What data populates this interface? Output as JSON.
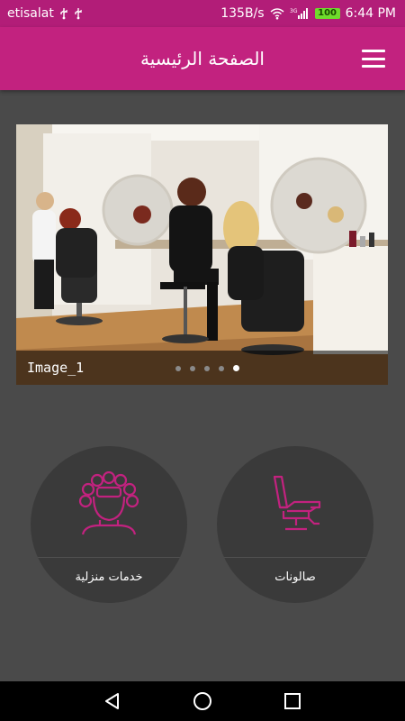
{
  "status_bar": {
    "carrier": "etisalat",
    "usb_icons": [
      "usb-icon",
      "usb-icon"
    ],
    "speed": "135B/s",
    "network": "3G",
    "battery": "100",
    "time": "6:44 PM"
  },
  "app_bar": {
    "title": "الصفحة الرئيسية",
    "menu_icon": "hamburger-menu-icon"
  },
  "slider": {
    "caption": "Image_1",
    "page_count": 5,
    "active_index": 4
  },
  "categories": [
    {
      "label": "خدمات منزلية",
      "icon": "curlers-head-icon"
    },
    {
      "label": "صالونات",
      "icon": "salon-chair-icon"
    }
  ],
  "colors": {
    "status_bar": "#b21d78",
    "app_bar": "#c2227f",
    "accent": "#c2227f",
    "background": "#4a4a4a",
    "circle": "#3a3a3a"
  },
  "nav_bar": {
    "icons": [
      "back-icon",
      "home-icon",
      "recent-apps-icon"
    ]
  }
}
